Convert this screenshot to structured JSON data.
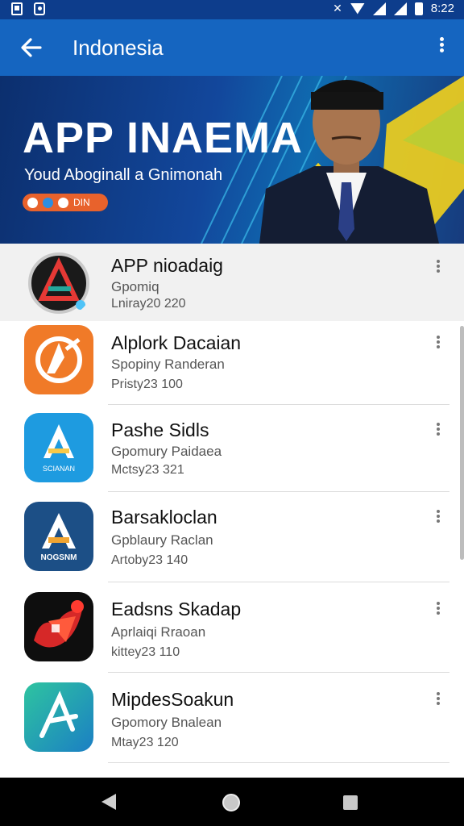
{
  "status_bar": {
    "time": "8:22"
  },
  "app_bar": {
    "title": "Indonesia"
  },
  "hero": {
    "title": "APP INAEMA",
    "subtitle": "Youd Aboginall a Gnimonah",
    "pill_text": "DIN"
  },
  "apps": [
    {
      "title": "APP nioadaig",
      "subtitle": "Gpomiq",
      "meta": "Lniray20  220",
      "icon": "app-store-round-icon",
      "selected": true
    },
    {
      "title": "Alplork Dacaian",
      "subtitle": "Spopiny Randeran",
      "meta": "Pristy23  100",
      "icon": "orange-badge-icon",
      "selected": false
    },
    {
      "title": "Pashe Sidls",
      "subtitle": "Gpomury Paidaea",
      "meta": "Mctsy23  321",
      "icon": "blue-a-icon",
      "icon_caption": "SCIANAN",
      "selected": false
    },
    {
      "title": "Barsakloclan",
      "subtitle": "Gpblaury Raclan",
      "meta": "Artoby23  140",
      "icon": "navy-a-icon",
      "icon_caption": "NOGSNM",
      "selected": false
    },
    {
      "title": "Eadsns Skadap",
      "subtitle": "Aprlaiqi Rraoan",
      "meta": "kittey23  110",
      "icon": "red-flame-icon",
      "selected": false
    },
    {
      "title": "MipdesSoakun",
      "subtitle": "Gpomory Bnalean",
      "meta": "Mtay23  120",
      "icon": "teal-a-icon",
      "selected": false
    }
  ],
  "colors": {
    "status_bar": "#0d3d8c",
    "app_bar": "#1565c0",
    "hero_pill": "#e8622c",
    "nav_bar": "#000000"
  }
}
